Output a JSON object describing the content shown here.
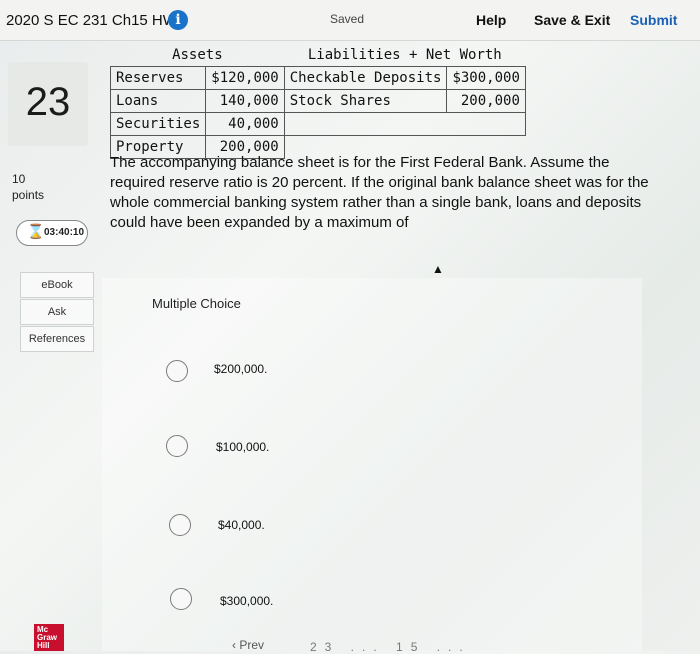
{
  "header": {
    "title": "2020 S EC 231 Ch15 HW",
    "status": "Saved",
    "help": "Help",
    "save_exit": "Save & Exit",
    "submit": "Submit",
    "info_icon": "i"
  },
  "sidebar": {
    "question_number": "23",
    "points_value": "10",
    "points_label": "points",
    "timer": "03:40:10",
    "buttons": [
      "eBook",
      "Ask",
      "References"
    ]
  },
  "balance_sheet": {
    "assets_header": "Assets",
    "liabilities_header": "Liabilities + Net Worth",
    "rows": [
      {
        "asset": "Reserves",
        "asset_value": "$120,000",
        "liability": "Checkable Deposits",
        "liability_value": "$300,000"
      },
      {
        "asset": "Loans",
        "asset_value": "140,000",
        "liability": "Stock Shares",
        "liability_value": "200,000"
      },
      {
        "asset": "Securities",
        "asset_value": "40,000",
        "liability": "",
        "liability_value": ""
      },
      {
        "asset": "Property",
        "asset_value": "200,000",
        "liability": "",
        "liability_value": ""
      }
    ]
  },
  "question": {
    "text": "The accompanying balance sheet is for the First Federal Bank. Assume the required reserve ratio is 20 percent. If the original bank balance sheet was for the whole commercial banking system rather than a single bank, loans and deposits could have been expanded by a maximum of",
    "type_label": "Multiple Choice",
    "choices": [
      "$200,000.",
      "$100,000.",
      "$40,000.",
      "$300,000."
    ]
  },
  "footer": {
    "logo": "Mc Graw Hill",
    "prev": "Prev",
    "pager": "23 ... 15 ..."
  },
  "colors": {
    "accent": "#1a60b5",
    "info_icon": "#1a73c9",
    "logo": "#c8102e",
    "timer_icon": "#3a8a3a"
  },
  "icons": {
    "info": "info-circle-icon",
    "timer": "hourglass-icon",
    "cursor": "cursor-arrow-icon",
    "prev": "chevron-left-icon"
  }
}
